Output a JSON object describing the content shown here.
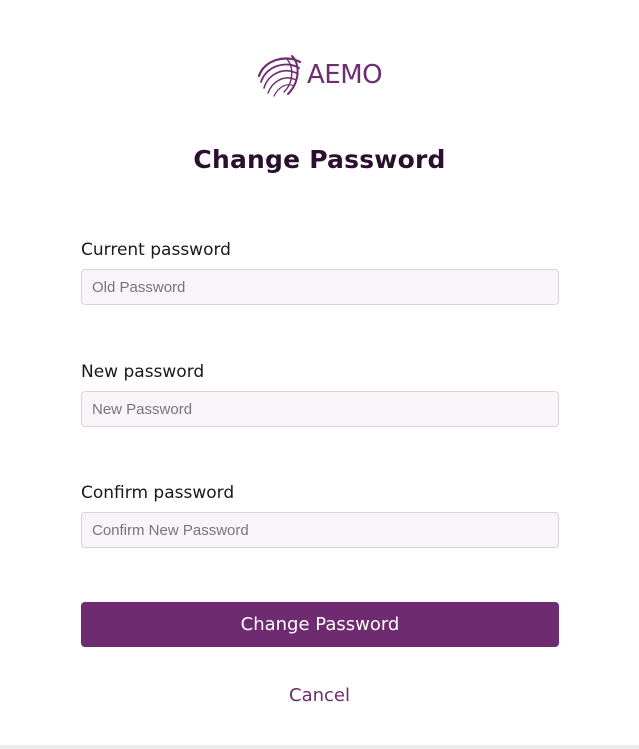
{
  "brand": {
    "name": "AEMO",
    "logo_icon": "aemo-swirl-logo",
    "color": "#6e2b70"
  },
  "page": {
    "title": "Change Password"
  },
  "form": {
    "current": {
      "label": "Current password",
      "placeholder": "Old Password",
      "value": ""
    },
    "new": {
      "label": "New password",
      "placeholder": "New Password",
      "value": ""
    },
    "confirm": {
      "label": "Confirm password",
      "placeholder": "Confirm New Password",
      "value": ""
    },
    "submit_label": "Change Password",
    "cancel_label": "Cancel"
  },
  "colors": {
    "primary": "#6e2b70",
    "title": "#2a0f2e",
    "input_bg": "#f8f4f8",
    "input_border": "#d9d3db"
  }
}
